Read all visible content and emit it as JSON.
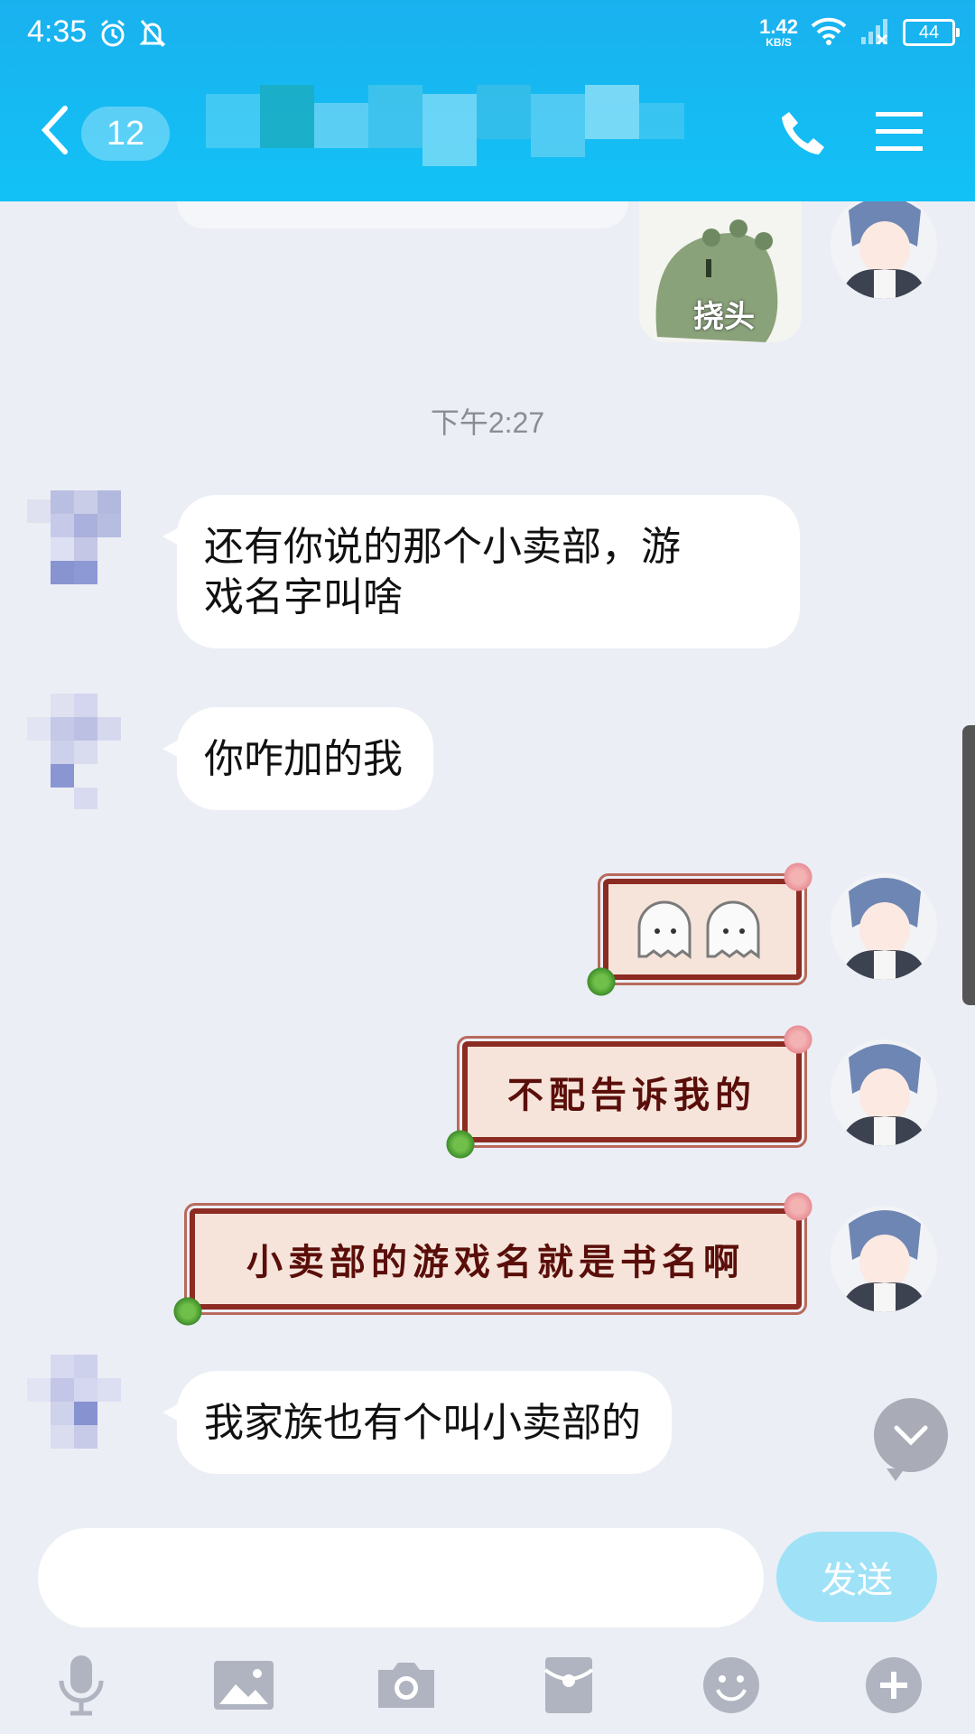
{
  "status_bar": {
    "time": "4:35",
    "net_speed": "1.42",
    "net_speed_unit": "KB/S",
    "battery": "44"
  },
  "header": {
    "unread_count": "12",
    "title_hidden": true
  },
  "chat": {
    "sticker_top_label": "挠头",
    "time_separator": "下午2:27",
    "messages": [
      {
        "side": "left",
        "type": "text",
        "text": "还有你说的那个小卖部，游戏名字叫啥",
        "lines": [
          "还有你说的那个小卖部，游",
          "戏名字叫啥"
        ]
      },
      {
        "side": "left",
        "type": "text",
        "text": "你咋加的我"
      },
      {
        "side": "right",
        "type": "sticker",
        "text": ""
      },
      {
        "side": "right",
        "type": "decorated_text",
        "text": "不配告诉我的"
      },
      {
        "side": "right",
        "type": "decorated_text",
        "text": "小卖部的游戏名就是书名啊"
      },
      {
        "side": "left",
        "type": "text",
        "text": "我家族也有个叫小卖部的"
      }
    ]
  },
  "input": {
    "placeholder": "",
    "value": "",
    "send_label": "发送"
  },
  "toolbar": {
    "icons": [
      "microphone-icon",
      "image-icon",
      "camera-icon",
      "red-packet-icon",
      "emoji-icon",
      "plus-icon"
    ]
  },
  "colors": {
    "header": "#1ab1ef",
    "chat_bg": "#eceef5",
    "bubble": "#ffffff",
    "send_button": "#9fe2f7",
    "sticker_frame": "#8c2b22",
    "sticker_text": "#5a0e0a"
  }
}
